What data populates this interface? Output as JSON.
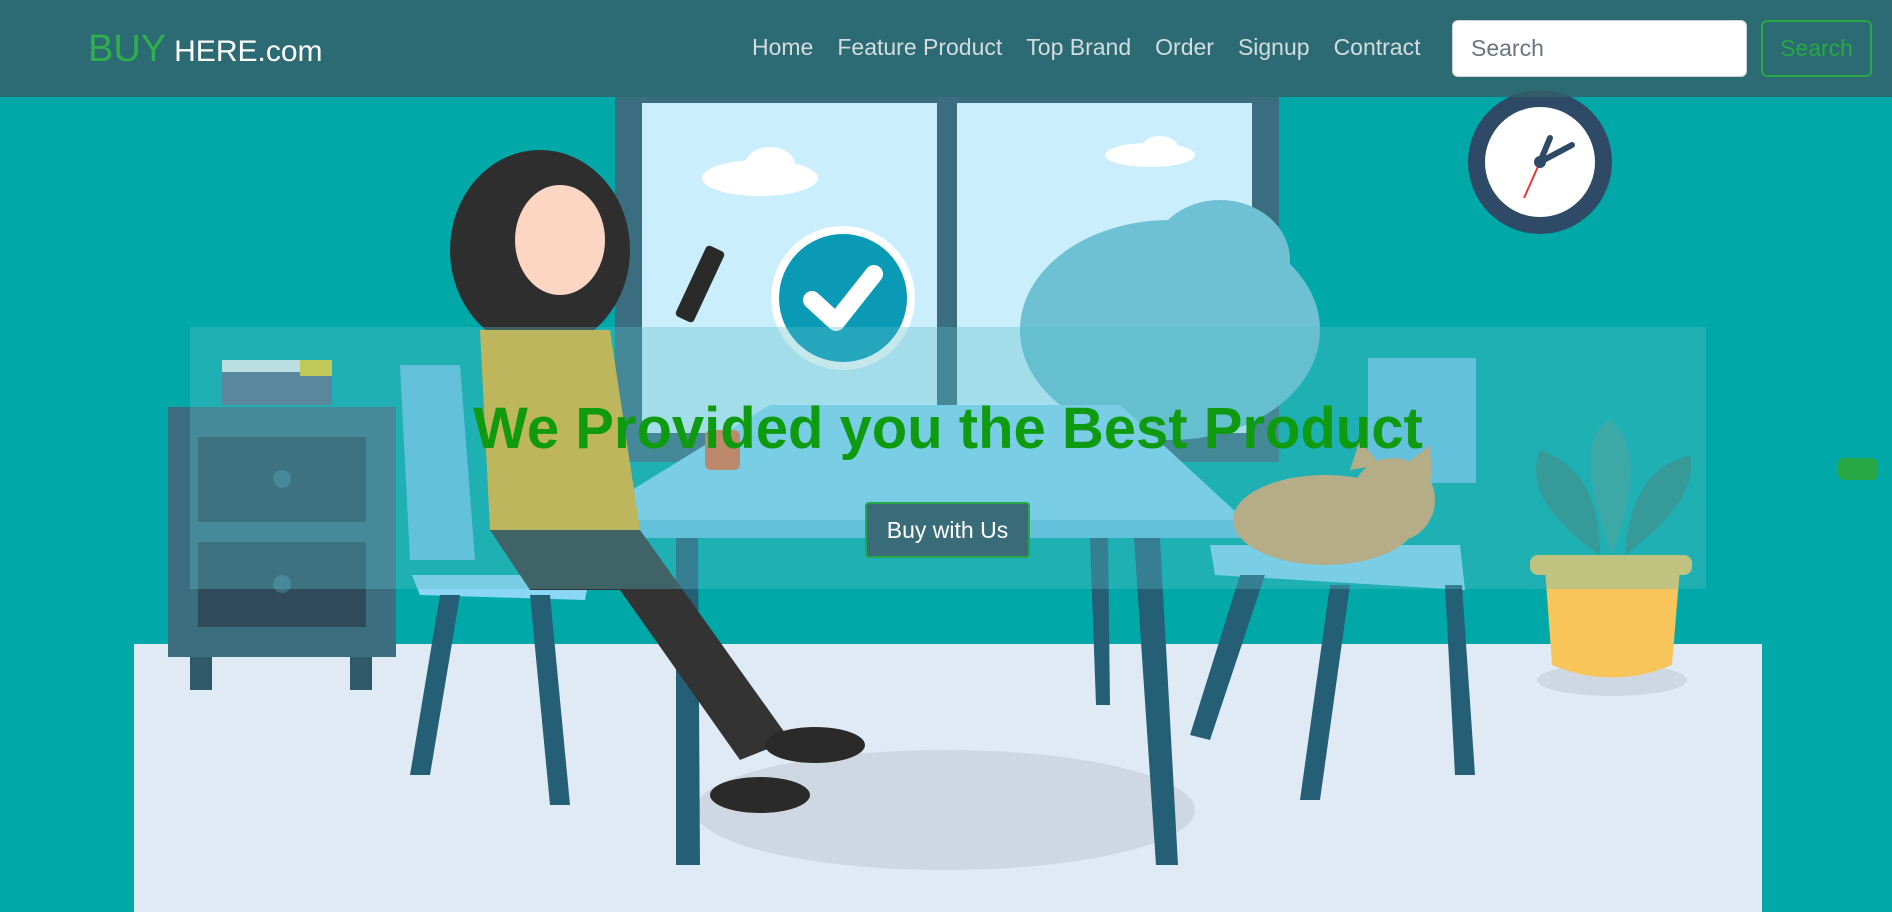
{
  "brand": {
    "highlight": "BUY",
    "rest": "HERE.com"
  },
  "nav": {
    "links": [
      "Home",
      "Feature Product",
      "Top Brand",
      "Order",
      "Signup",
      "Contract"
    ]
  },
  "search": {
    "placeholder": "Search",
    "button_label": "Search"
  },
  "hero": {
    "headline": "We Provided you the Best Product",
    "cta_label": "Buy with Us"
  },
  "colors": {
    "background": "#00a9a8",
    "navbar": "#345f6b",
    "brand_accent": "#2fae4e",
    "headline": "#109a10",
    "button_border": "#28a745"
  }
}
